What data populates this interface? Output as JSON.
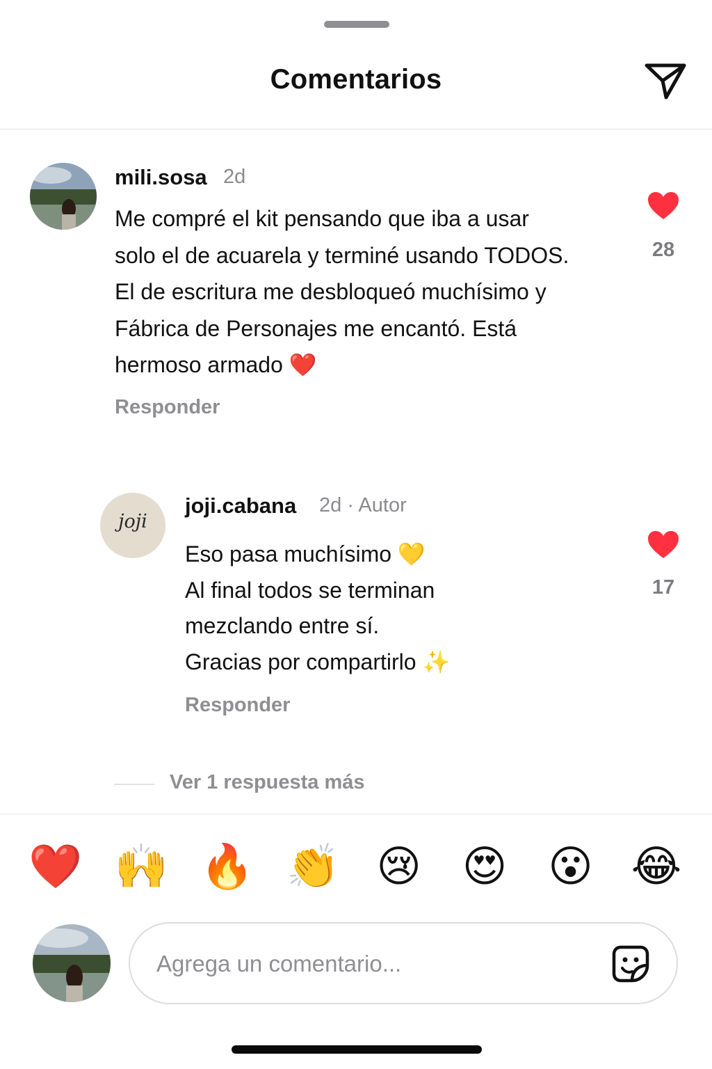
{
  "header": {
    "title": "Comentarios",
    "share_icon": "send-icon"
  },
  "comments": [
    {
      "username": "mili.sosa",
      "time": "2d",
      "lines": [
        "Me compré el kit pensando que iba a usar",
        "solo el de acuarela y terminé usando TODOS.",
        "El de escritura me desbloqueó muchísimo y",
        "Fábrica de Personajes me encantó. Está",
        "hermoso armado ❤️"
      ],
      "likes": "28",
      "liked": true,
      "reply_label": "Responder"
    },
    {
      "username": "joji.cabana",
      "time": "2d · Autor",
      "avatar_text": "joji",
      "lines": [
        "Eso pasa muchísimo 💛",
        "Al final todos se terminan",
        "mezclando entre sí.",
        "Gracias por compartirlo ✨"
      ],
      "likes": "17",
      "liked": true,
      "reply_label": "Responder"
    }
  ],
  "more_replies": "Ver 1 respuesta más",
  "quick_reactions": [
    "❤️",
    "🙌",
    "🔥",
    "👏",
    "😢",
    "😍",
    "😮",
    "😂"
  ],
  "composer": {
    "placeholder": "Agrega un comentario...",
    "value": "",
    "sticker_icon": "sticker-icon"
  },
  "colors": {
    "like": "#ff3040",
    "muted": "#8e8e93",
    "text": "#111111"
  }
}
